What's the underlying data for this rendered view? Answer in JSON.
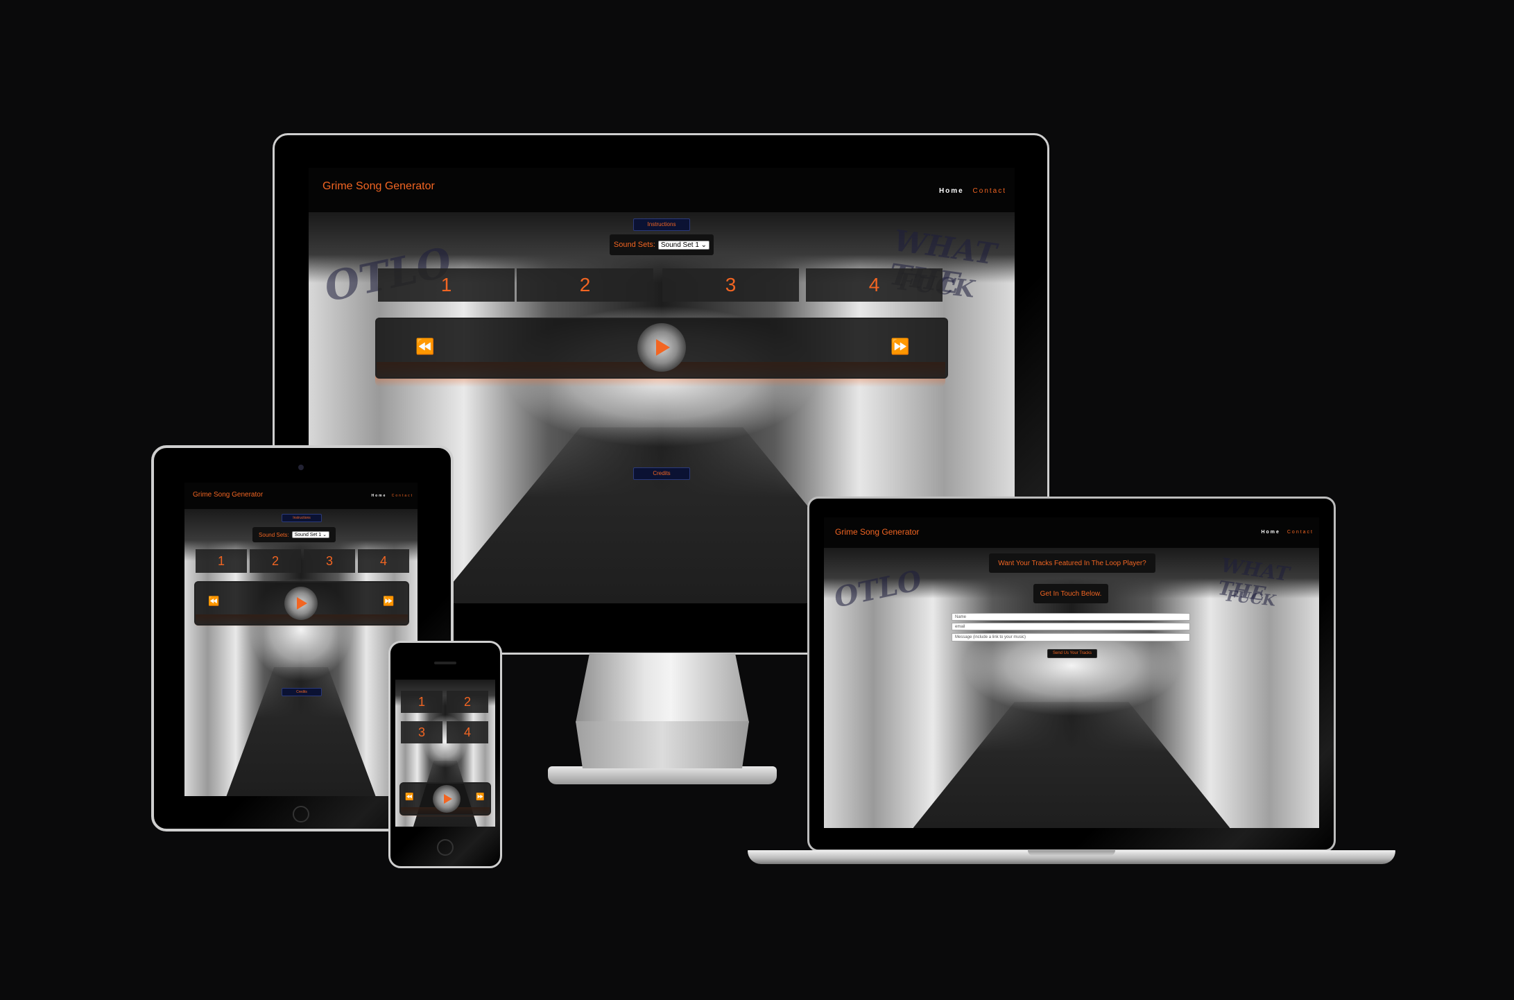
{
  "site": {
    "brand": "Grime Song Generator",
    "nav_home": "Home",
    "nav_contact": "Contact"
  },
  "home": {
    "instructions_button": "Instructions",
    "sound_sets_label": "Sound Sets:",
    "sound_set_selected": "Sound Set 1",
    "pads": [
      "1",
      "2",
      "3",
      "4"
    ],
    "credits_button": "Credits"
  },
  "contact": {
    "headline": "Want Your Tracks Featured In The Loop Player?",
    "cta": "Get In Touch Below.",
    "name_placeholder": "Name",
    "email_placeholder": "email",
    "message_placeholder": "Message (include a link to your music)",
    "submit": "Send Us Your Tracks"
  },
  "graffiti": [
    "OTLO",
    "WHAT THE",
    "FUCK"
  ],
  "colors": {
    "accent": "#f26522",
    "background": "#0a0a0b",
    "nav": "#050505",
    "button_navy": "#0b1233"
  },
  "icons": {
    "rewind": "rewind-icon",
    "fast_forward": "fast-forward-icon",
    "play": "play-icon"
  }
}
